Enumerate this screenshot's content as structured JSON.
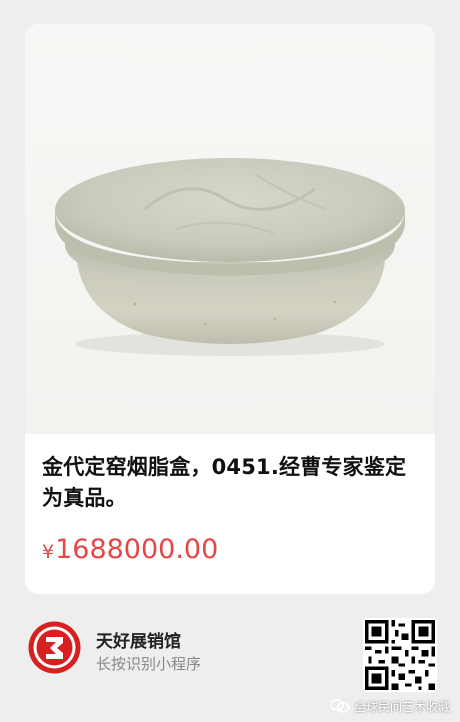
{
  "product": {
    "image_alt": "金代定窑烟脂盒",
    "title": "金代定窑烟脂盒，0451.经曹专家鉴定为真品。",
    "price_symbol": "¥",
    "price_value": "1688000.00"
  },
  "shop": {
    "name": "天好展销馆",
    "hint": "长按识别小程序",
    "logo_icon": "shop-logo-icon",
    "qr_icon": "qr-code-icon"
  },
  "watermark": {
    "text": "全球民间艺术收藏",
    "icon": "wechat-channel-icon"
  },
  "colors": {
    "price": "#e24848",
    "logo_red": "#d82020",
    "background": "#eeeeee",
    "card": "#ffffff"
  }
}
